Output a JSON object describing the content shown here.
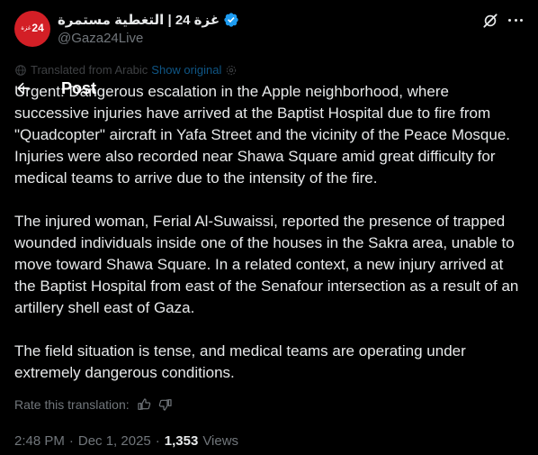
{
  "author": {
    "avatar_number": "24",
    "avatar_word": "غزة",
    "display_name": "غزة 24 | التغطية مستمرة",
    "handle": "@Gaza24Live"
  },
  "header": {
    "title": "Post",
    "back_icon": "arrow-left-icon",
    "actions": [
      "grok-icon",
      "more-icon"
    ]
  },
  "translation": {
    "label": "Translated from Arabic",
    "show_original": "Show original",
    "rate_label": "Rate this translation:"
  },
  "post": {
    "paragraphs": [
      "Urgent: Dangerous escalation in the Apple neighborhood, where successive injuries have arrived at the Baptist Hospital due to fire from \"Quadcopter\" aircraft in Yafa Street and the vicinity of the Peace Mosque. Injuries were also recorded near Shawa Square amid great difficulty for medical teams to arrive due to the intensity of the fire.",
      "The injured woman, Ferial Al-Suwaissi, reported the presence of trapped wounded individuals inside one of the houses in the Sakra area, unable to move toward Shawa Square. In a related context, a new injury arrived at the Baptist Hospital from east of the Senafour intersection as a result of an artillery shell east of Gaza.",
      "The field situation is tense, and medical teams are operating under extremely dangerous conditions."
    ]
  },
  "meta": {
    "time": "2:48 PM",
    "separator": "·",
    "date": "Dec 1, 2025",
    "views_count": "1,353",
    "views_label": "Views"
  },
  "colors": {
    "background": "#000000",
    "text": "#e7e9ea",
    "secondary": "#71767b",
    "accent": "#1d9bf0",
    "avatar_bg": "#d31f26"
  }
}
